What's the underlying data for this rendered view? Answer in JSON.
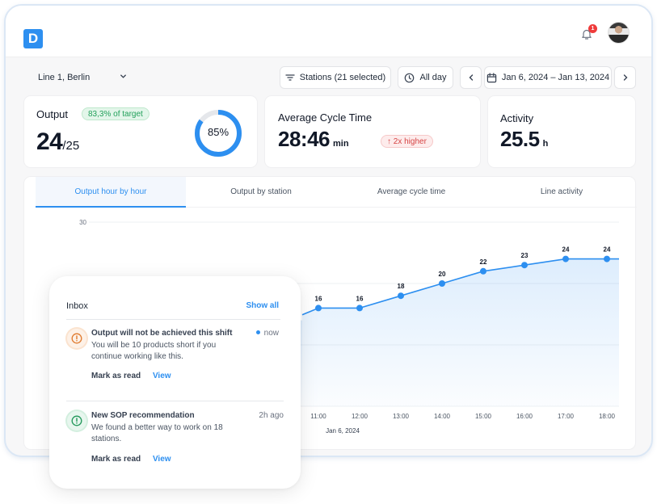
{
  "app": {
    "logo_letter": "D",
    "notification_count": "1",
    "avatar_alt": "User avatar"
  },
  "filters": {
    "line": "Line 1, Berlin",
    "stations": "Stations (21 selected)",
    "time": "All day",
    "date_range": "Jan 6, 2024 – Jan 13, 2024"
  },
  "kpis": {
    "output": {
      "title": "Output",
      "badge": "83,3% of target",
      "value": "24",
      "target": "/25",
      "donut_percent": 85,
      "donut_label": "85%"
    },
    "cycle_time": {
      "title": "Average Cycle Time",
      "value": "28:46",
      "unit": "min",
      "badge": "↑ 2x higher"
    },
    "activity": {
      "title": "Activity",
      "value": "25.5",
      "unit": "h"
    }
  },
  "tabs": [
    {
      "label": "Output hour by hour",
      "active": true
    },
    {
      "label": "Output by station",
      "active": false
    },
    {
      "label": "Average cycle time",
      "active": false
    },
    {
      "label": "Line activity",
      "active": false
    }
  ],
  "chart_data": {
    "type": "area",
    "title": "Output hour by hour",
    "x": [
      "11:00",
      "12:00",
      "13:00",
      "14:00",
      "15:00",
      "16:00",
      "17:00",
      "18:00"
    ],
    "series": [
      {
        "name": "Output",
        "values": [
          16,
          16,
          18,
          20,
          22,
          23,
          24,
          24
        ],
        "color": "#2d8ff0"
      }
    ],
    "y_ticks_visible": [
      "30"
    ],
    "ylim": [
      0,
      30
    ],
    "gridlines": [
      0,
      10,
      20,
      30
    ],
    "grid": true,
    "date_label": "Jan 6, 2024",
    "xlabel": "",
    "ylabel": ""
  },
  "inbox": {
    "title": "Inbox",
    "show_all": "Show all",
    "messages": [
      {
        "title": "Output will not be achieved this shift",
        "body": "You will be 10 products short if you continue working like this.",
        "time": "now",
        "unread": true,
        "icon": "warning-icon",
        "color": "#e07a2e",
        "mark_read": "Mark as read",
        "view": "View"
      },
      {
        "title": "New SOP recommendation",
        "body": "We found a better way to work on 18 stations.",
        "time": "2h ago",
        "unread": false,
        "icon": "info-icon",
        "color": "#21985a",
        "mark_read": "Mark as read",
        "view": "View"
      }
    ]
  }
}
